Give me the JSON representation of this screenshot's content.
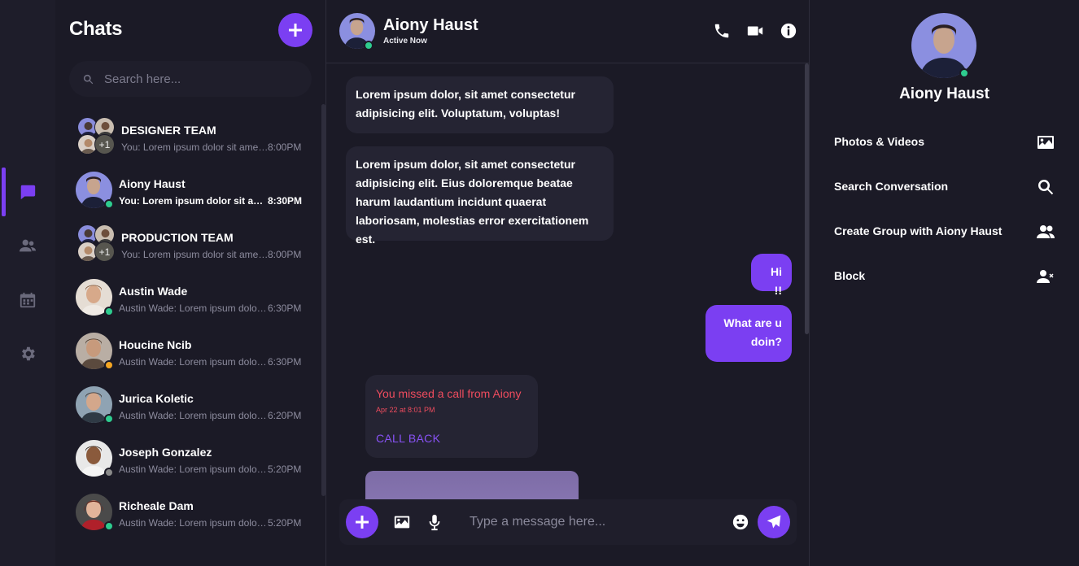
{
  "nav": {
    "items": [
      {
        "icon": "chat-bubble-icon",
        "active": true
      },
      {
        "icon": "contacts-icon",
        "active": false
      },
      {
        "icon": "calendar-icon",
        "active": false
      },
      {
        "icon": "settings-gear-icon",
        "active": false
      }
    ]
  },
  "chats": {
    "title": "Chats",
    "search_placeholder": "Search here...",
    "items": [
      {
        "name": "DESIGNER TEAM",
        "message": "You: Lorem ipsum dolor sit amet consectetur",
        "time": "8:00PM",
        "group": true,
        "extra": "+1",
        "unread": false
      },
      {
        "name": "Aiony Haust",
        "message": "You: Lorem ipsum dolor sit amet consectetur",
        "time": "8:30PM",
        "group": false,
        "status": "online",
        "unread": true
      },
      {
        "name": "PRODUCTION TEAM",
        "message": "You: Lorem ipsum dolor sit amet consectetur",
        "time": "8:00PM",
        "group": true,
        "extra": "+1",
        "unread": false
      },
      {
        "name": "Austin Wade",
        "message": "Austin Wade: Lorem ipsum dolor sit amet",
        "time": "6:30PM",
        "group": false,
        "status": "online",
        "unread": false
      },
      {
        "name": "Houcine Ncib",
        "message": "Austin Wade: Lorem ipsum dolor sit amet",
        "time": "6:30PM",
        "group": false,
        "status": "away",
        "unread": false
      },
      {
        "name": "Jurica Koletic",
        "message": "Austin Wade: Lorem ipsum dolor sit amet",
        "time": "6:20PM",
        "group": false,
        "status": "online",
        "unread": false
      },
      {
        "name": "Joseph Gonzalez",
        "message": "Austin Wade: Lorem ipsum dolor sit amet",
        "time": "5:20PM",
        "group": false,
        "status": "offline",
        "unread": false
      },
      {
        "name": "Richeale Dam",
        "message": "Austin Wade: Lorem ipsum dolor sit amet",
        "time": "5:20PM",
        "group": false,
        "status": "online",
        "unread": false
      }
    ]
  },
  "conversation": {
    "contact_name": "Aiony Haust",
    "contact_status": "Active Now",
    "messages": [
      {
        "direction": "in",
        "text": "Lorem ipsum dolor, sit amet consectetur adipisicing elit. Voluptatum, voluptas!"
      },
      {
        "direction": "in",
        "text": "Lorem ipsum dolor, sit amet consectetur adipisicing elit. Eius doloremque beatae harum laudantium incidunt quaerat laboriosam, molestias error exercitationem est."
      },
      {
        "direction": "out",
        "text": "Hi !!"
      },
      {
        "direction": "out",
        "text": "What are u doin?"
      }
    ],
    "missed_call": {
      "title": "You missed a call from Aiony",
      "time": "Apr 22 at 8:01 PM",
      "action": "CALL BACK"
    },
    "composer_placeholder": "Type a message here..."
  },
  "info": {
    "name": "Aiony Haust",
    "rows": [
      {
        "label": "Photos & Videos",
        "icon": "image-icon"
      },
      {
        "label": "Search Conversation",
        "icon": "search-icon"
      },
      {
        "label": "Create Group with Aiony Haust",
        "icon": "group-icon"
      },
      {
        "label": "Block",
        "icon": "block-user-icon"
      }
    ]
  },
  "colors": {
    "accent": "#7b3ff2",
    "background": "#1b1a26",
    "bubble_in": "#252433",
    "online": "#2ecc8f",
    "away": "#f5a623",
    "offline": "#8a8a8a",
    "missed": "#ef4c5e"
  }
}
